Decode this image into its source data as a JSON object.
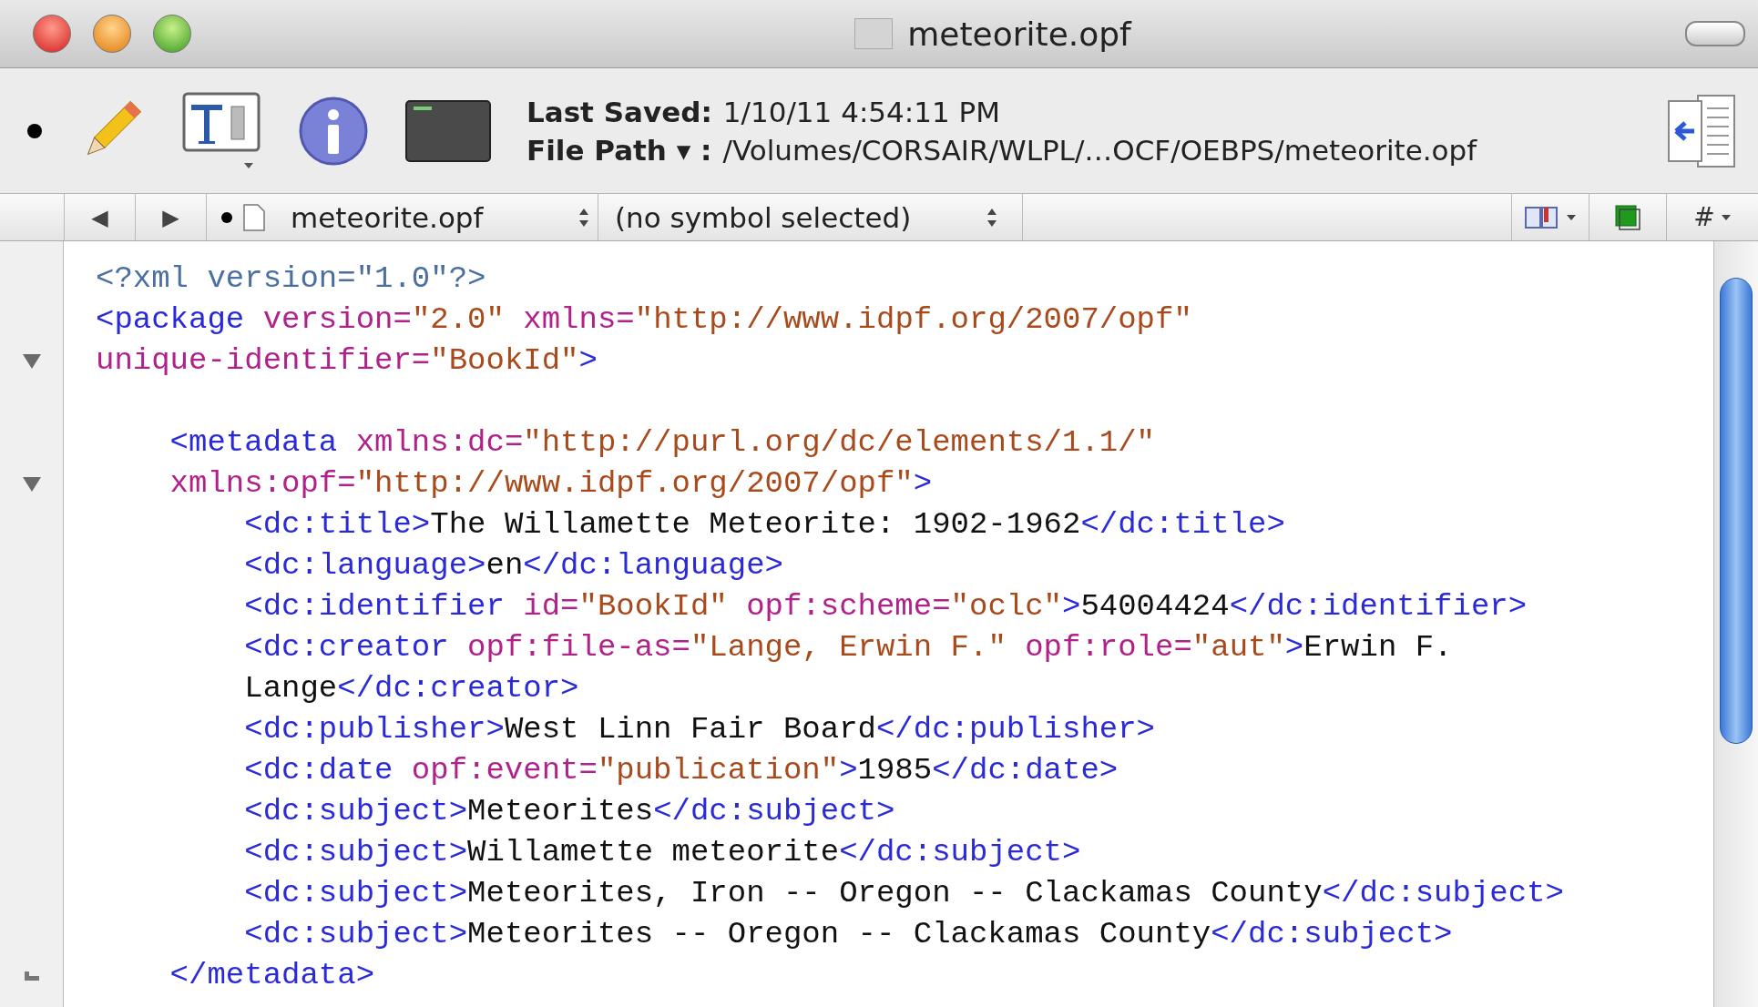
{
  "window": {
    "title": "meteorite.opf"
  },
  "toolbar": {
    "last_saved_label": "Last Saved:",
    "last_saved": "1/10/11 4:54:11 PM",
    "file_path_label": "File Path ▾ :",
    "file_path": "/Volumes/CORSAIR/WLPL/…OCF/OEBPS/meteorite.opf"
  },
  "navbar": {
    "back": "◀",
    "forward": "▶",
    "file_menu": "meteorite.opf",
    "symbol_menu": "(no symbol selected)",
    "counterpart_menu": "#"
  },
  "editor": {
    "lines": [
      {
        "tokens": [
          {
            "kind": "pi",
            "text": "<?xml version=\"1.0\"?>"
          }
        ]
      },
      {
        "tokens": [
          {
            "kind": "tag",
            "text": "<package"
          },
          {
            "kind": "attr",
            "text": " version="
          },
          {
            "kind": "value",
            "text": "\"2.0\""
          },
          {
            "kind": "attr",
            "text": " xmlns="
          },
          {
            "kind": "value",
            "text": "\"http://www.idpf.org/2007/opf\""
          }
        ]
      },
      {
        "kind": "fold_start",
        "tokens": [
          {
            "kind": "attr",
            "text": "unique-identifier="
          },
          {
            "kind": "value",
            "text": "\"BookId\""
          },
          {
            "kind": "tag",
            "text": ">"
          }
        ]
      },
      {
        "kind": "blank"
      },
      {
        "tokens": [
          {
            "kind": "tag",
            "text": "    <metadata"
          },
          {
            "kind": "attr",
            "text": " xmlns:dc="
          },
          {
            "kind": "value",
            "text": "\"http://purl.org/dc/elements/1.1/\""
          }
        ]
      },
      {
        "kind": "fold_start",
        "tokens": [
          {
            "kind": "attr",
            "text": "    xmlns:opf="
          },
          {
            "kind": "value",
            "text": "\"http://www.idpf.org/2007/opf\""
          },
          {
            "kind": "tag",
            "text": ">"
          }
        ]
      },
      {
        "tokens": [
          {
            "kind": "tag",
            "text": "        <dc:title>"
          },
          {
            "kind": "text",
            "text": "The Willamette Meteorite: 1902-1962"
          },
          {
            "kind": "tag",
            "text": "</dc:title>"
          }
        ]
      },
      {
        "tokens": [
          {
            "kind": "tag",
            "text": "        <dc:language>"
          },
          {
            "kind": "text",
            "text": "en"
          },
          {
            "kind": "tag",
            "text": "</dc:language>"
          }
        ]
      },
      {
        "tokens": [
          {
            "kind": "tag",
            "text": "        <dc:identifier"
          },
          {
            "kind": "attr",
            "text": " id="
          },
          {
            "kind": "value",
            "text": "\"BookId\""
          },
          {
            "kind": "attr",
            "text": " opf:scheme="
          },
          {
            "kind": "value",
            "text": "\"oclc\""
          },
          {
            "kind": "tag",
            "text": ">"
          },
          {
            "kind": "text",
            "text": "54004424"
          },
          {
            "kind": "tag",
            "text": "</dc:identifier>"
          }
        ]
      },
      {
        "tokens": [
          {
            "kind": "tag",
            "text": "        <dc:creator"
          },
          {
            "kind": "attr",
            "text": " opf:file-as="
          },
          {
            "kind": "value",
            "text": "\"Lange, Erwin F.\""
          },
          {
            "kind": "attr",
            "text": " opf:role="
          },
          {
            "kind": "value",
            "text": "\"aut\""
          },
          {
            "kind": "tag",
            "text": ">"
          },
          {
            "kind": "text",
            "text": "Erwin F."
          }
        ]
      },
      {
        "tokens": [
          {
            "kind": "text",
            "text": "        Lange"
          },
          {
            "kind": "tag",
            "text": "</dc:creator>"
          }
        ]
      },
      {
        "tokens": [
          {
            "kind": "tag",
            "text": "        <dc:publisher>"
          },
          {
            "kind": "text",
            "text": "West Linn Fair Board"
          },
          {
            "kind": "tag",
            "text": "</dc:publisher>"
          }
        ]
      },
      {
        "tokens": [
          {
            "kind": "tag",
            "text": "        <dc:date"
          },
          {
            "kind": "attr",
            "text": " opf:event="
          },
          {
            "kind": "value",
            "text": "\"publication\""
          },
          {
            "kind": "tag",
            "text": ">"
          },
          {
            "kind": "text",
            "text": "1985"
          },
          {
            "kind": "tag",
            "text": "</dc:date>"
          }
        ]
      },
      {
        "tokens": [
          {
            "kind": "tag",
            "text": "        <dc:subject>"
          },
          {
            "kind": "text",
            "text": "Meteorites"
          },
          {
            "kind": "tag",
            "text": "</dc:subject>"
          }
        ]
      },
      {
        "tokens": [
          {
            "kind": "tag",
            "text": "        <dc:subject>"
          },
          {
            "kind": "text",
            "text": "Willamette meteorite"
          },
          {
            "kind": "tag",
            "text": "</dc:subject>"
          }
        ]
      },
      {
        "tokens": [
          {
            "kind": "tag",
            "text": "        <dc:subject>"
          },
          {
            "kind": "text",
            "text": "Meteorites, Iron -- Oregon -- Clackamas County"
          },
          {
            "kind": "tag",
            "text": "</dc:subject>"
          }
        ]
      },
      {
        "tokens": [
          {
            "kind": "tag",
            "text": "        <dc:subject>"
          },
          {
            "kind": "text",
            "text": "Meteorites -- Oregon -- Clackamas County"
          },
          {
            "kind": "tag",
            "text": "</dc:subject>"
          }
        ]
      },
      {
        "kind": "fold_end",
        "tokens": [
          {
            "kind": "tag",
            "text": "    </metadata>"
          }
        ]
      }
    ]
  }
}
